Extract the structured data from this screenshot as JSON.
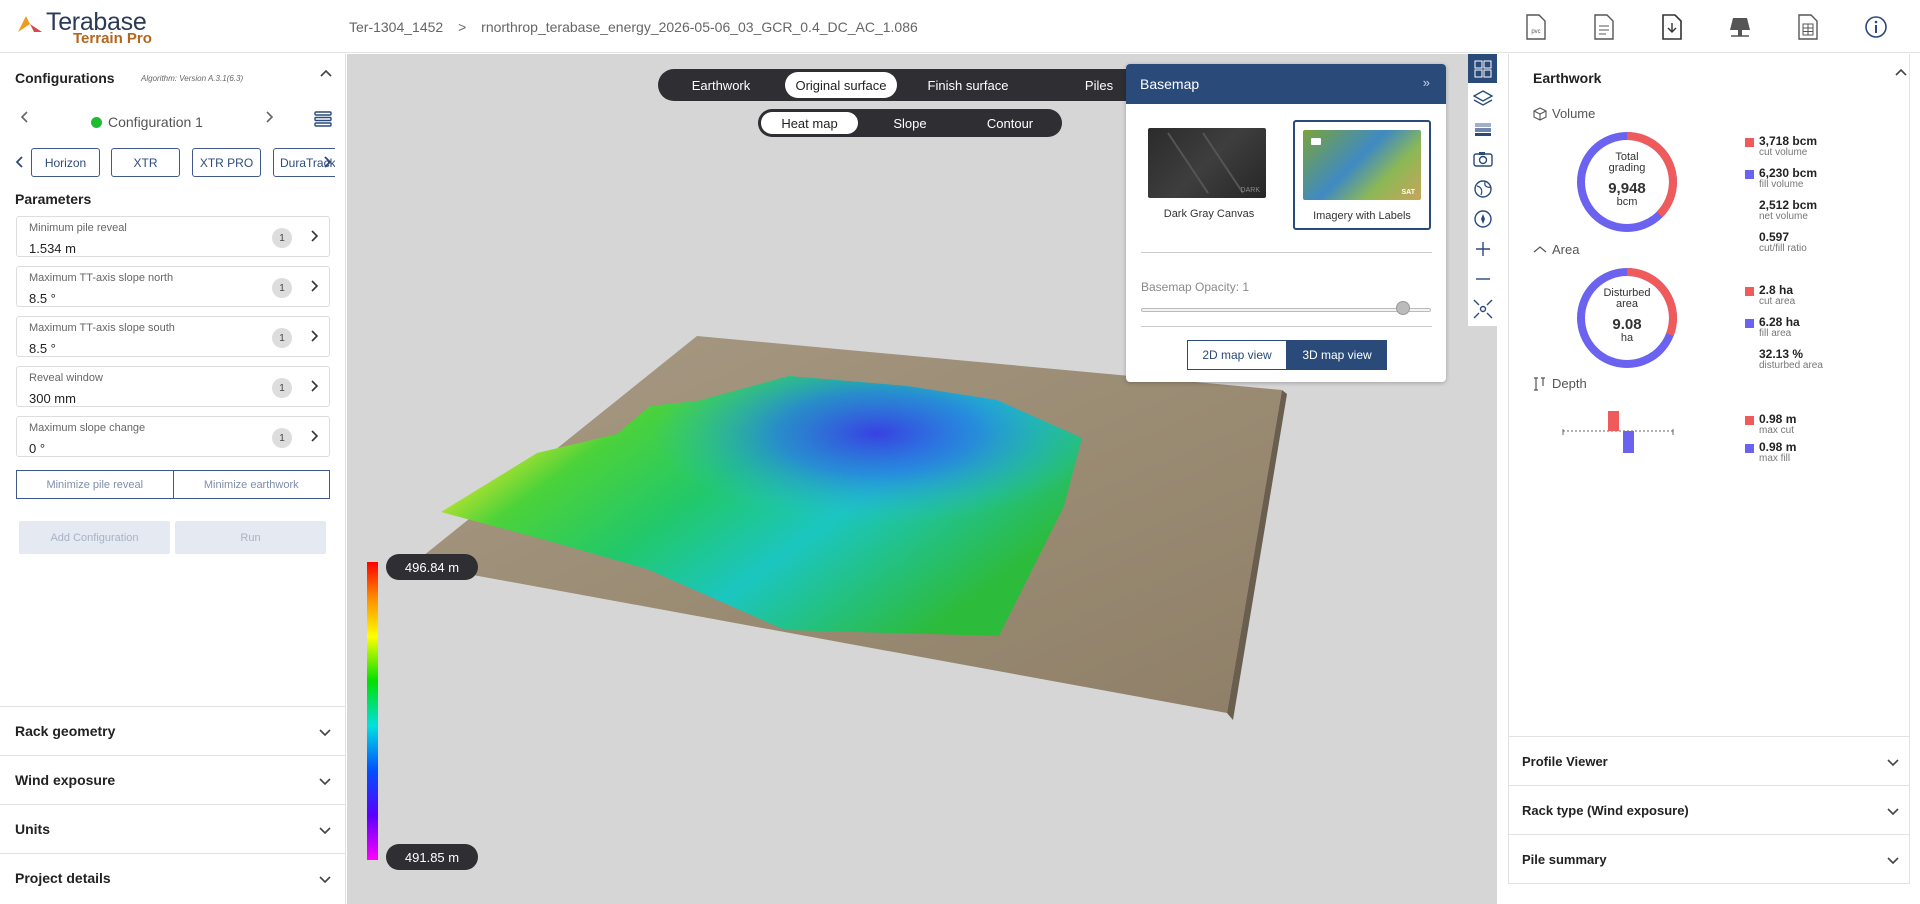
{
  "header": {
    "logo_title": "Terabase",
    "logo_sub": "Terrain Pro",
    "breadcrumb_project": "Ter-1304_1452",
    "breadcrumb_sep": ">",
    "breadcrumb_file": "rnorthrop_terabase_energy_2026-05-06_03_GCR_0.4_DC_AC_1.086",
    "icons": [
      "pvc-file-icon",
      "document-icon",
      "pdf-download-icon",
      "solar-panel-icon",
      "spreadsheet-icon",
      "info-icon"
    ],
    "pvc_label": "pvc"
  },
  "left": {
    "title": "Configurations",
    "algorithm": "Algorithm: Version A.3.1(6.3)",
    "config_name": "Configuration 1",
    "config_status_color": "#1ebd2f",
    "trackers": [
      "Horizon",
      "XTR",
      "XTR PRO",
      "DuraTrack"
    ],
    "params_title": "Parameters",
    "params": [
      {
        "label": "Minimum pile reveal",
        "value": "1.534 m",
        "count": "1"
      },
      {
        "label": "Maximum TT-axis slope north",
        "value": "8.5 °",
        "count": "1"
      },
      {
        "label": "Maximum TT-axis slope south",
        "value": "8.5 °",
        "count": "1"
      },
      {
        "label": "Reveal window",
        "value": "300 mm",
        "count": "1"
      },
      {
        "label": "Maximum slope change",
        "value": "0 °",
        "count": "1"
      }
    ],
    "minimize_pile": "Minimize pile reveal",
    "minimize_earth": "Minimize earthwork",
    "add_config": "Add Configuration",
    "run": "Run",
    "sections": [
      "Rack geometry",
      "Wind exposure",
      "Units",
      "Project details"
    ]
  },
  "map": {
    "tabs": [
      "Earthwork",
      "Original surface",
      "Finish surface",
      "Piles"
    ],
    "active_tab": "Original surface",
    "subtabs": [
      "Heat map",
      "Slope",
      "Contour"
    ],
    "active_subtab": "Heat map",
    "legend_max": "496.84 m",
    "legend_min": "491.85 m",
    "basemap": {
      "title": "Basemap",
      "collapse": "»",
      "options": [
        {
          "name": "Dark Gray Canvas",
          "tag": "DARK"
        },
        {
          "name": "Imagery with Labels",
          "tag": "SAT"
        }
      ],
      "selected": "Imagery with Labels",
      "opacity_label": "Basemap Opacity: 1",
      "opacity": 1,
      "view_2d": "2D map view",
      "view_3d": "3D map view",
      "active_view": "3D map view"
    },
    "tools": [
      "basemap-gallery-icon",
      "layers-icon",
      "stacked-layers-icon",
      "camera-icon",
      "globe-icon",
      "compass-icon",
      "zoom-in-icon",
      "zoom-out-icon",
      "fit-extent-icon"
    ]
  },
  "right": {
    "title": "Earthwork",
    "volume": {
      "title": "Volume",
      "center_label": "Total grading",
      "center_value": "9,948",
      "center_unit": "bcm",
      "cut_fraction": 0.374,
      "stats": [
        {
          "value": "3,718 bcm",
          "label": "cut volume",
          "color": "#ef5b5b"
        },
        {
          "value": "6,230 bcm",
          "label": "fill volume",
          "color": "#6b63f0"
        },
        {
          "value": "2,512 bcm",
          "label": "net volume",
          "color": ""
        },
        {
          "value": "0.597",
          "label": "cut/fill ratio",
          "color": ""
        }
      ]
    },
    "area": {
      "title": "Area",
      "center_label": "Disturbed area",
      "center_value": "9.08",
      "center_unit": "ha",
      "cut_fraction": 0.308,
      "stats": [
        {
          "value": "2.8 ha",
          "label": "cut area",
          "color": "#ef5b5b"
        },
        {
          "value": "6.28 ha",
          "label": "fill area",
          "color": "#6b63f0"
        },
        {
          "value": "32.13 %",
          "label": "disturbed area",
          "color": ""
        }
      ]
    },
    "depth": {
      "title": "Depth",
      "stats": [
        {
          "value": "0.98 m",
          "label": "max cut",
          "color": "#ef5b5b"
        },
        {
          "value": "0.98 m",
          "label": "max fill",
          "color": "#6b63f0"
        }
      ]
    },
    "sections": [
      "Profile Viewer",
      "Rack type (Wind exposure)",
      "Pile summary"
    ]
  },
  "colors": {
    "accent": "#2a4a7a",
    "cut": "#ef5b5b",
    "fill": "#6b63f0"
  }
}
